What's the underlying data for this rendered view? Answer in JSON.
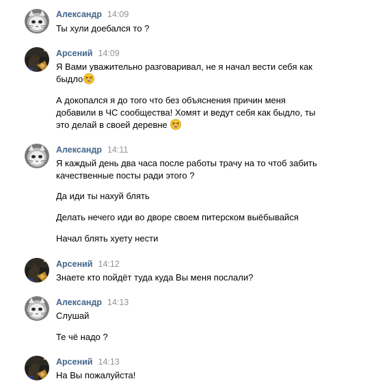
{
  "messages": [
    {
      "author": "Александр",
      "time": "14:09",
      "avatar_icon": "cat-avatar-icon",
      "lines": [
        "Ты хули доебался то ?"
      ]
    },
    {
      "author": "Арсений",
      "time": "14:09",
      "avatar_icon": "dark-photo-avatar-icon",
      "lines": [
        "Я Вами уважительно разговаривал, не я начал вести себя как",
        "быдло",
        "А докопался я до того что без объяснения причин меня",
        "добавили в ЧС сообщества! Хомят и ведут себя как быдло, ты",
        "это делай в своей деревне"
      ]
    },
    {
      "author": "Александр",
      "time": "14:11",
      "avatar_icon": "cat-avatar-icon",
      "lines": [
        "Я каждый день два часа после работы трачу на то чтоб забить",
        "качественные посты ради этого ?",
        "Да иди ты нахуй блять",
        "Делать нечего иди во дворе своем питерском выёбывайся",
        "Начал блять хуету нести"
      ]
    },
    {
      "author": "Арсений",
      "time": "14:12",
      "avatar_icon": "dark-photo-avatar-icon",
      "lines": [
        "Знаете кто пойдёт туда куда Вы меня послали?"
      ]
    },
    {
      "author": "Александр",
      "time": "14:13",
      "avatar_icon": "cat-avatar-icon",
      "lines": [
        "Слушай",
        "Те чё надо ?"
      ]
    },
    {
      "author": "Арсений",
      "time": "14:13",
      "avatar_icon": "dark-photo-avatar-icon",
      "lines": [
        "На Вы пожалуйста!"
      ]
    }
  ],
  "emoji_icon": "grinning-squint-emoji-icon",
  "colors": {
    "author_name": "#42648b",
    "timestamp": "#939393",
    "text": "#000000",
    "background": "#ffffff"
  }
}
